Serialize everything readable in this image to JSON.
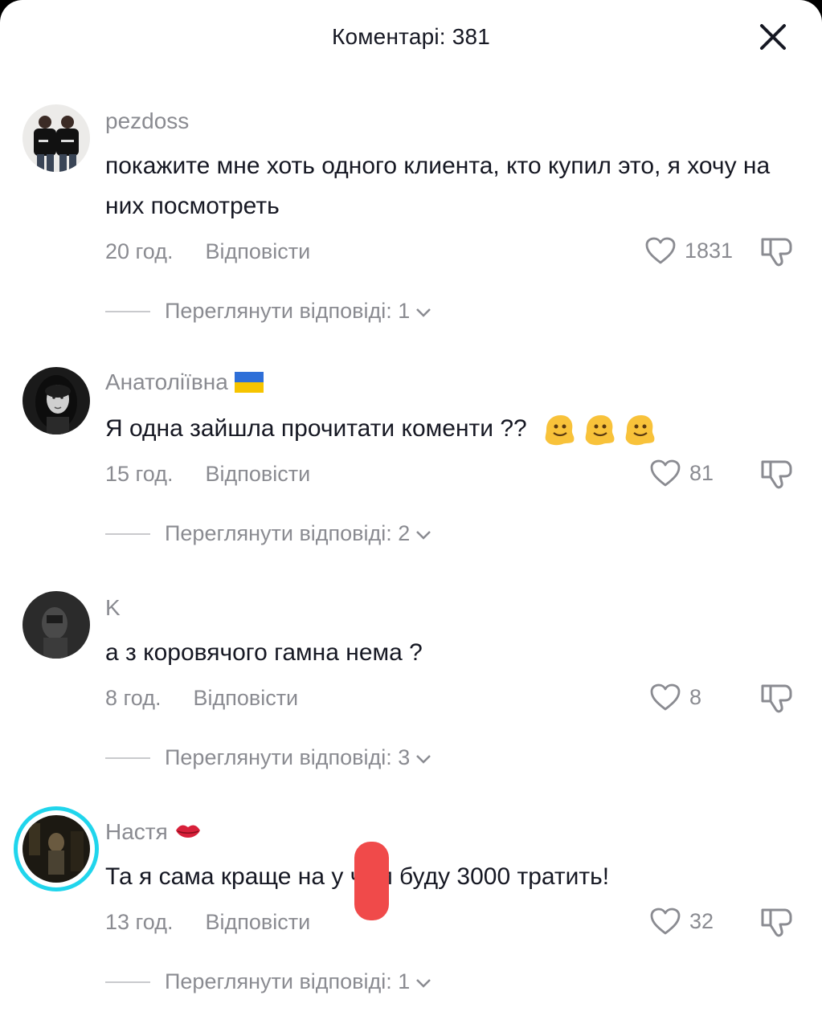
{
  "header": {
    "title": "Коментарі: 381"
  },
  "comments": [
    {
      "username": "pezdoss",
      "badge": "",
      "text": "покажите мне хоть одного клиента, кто купил это, я хочу на них посмотреть",
      "time": "20 год.",
      "reply_label": "Відповісти",
      "likes": "1831",
      "view_replies": "Переглянути відповіді: 1",
      "avatar": "couple-tshirts-photo"
    },
    {
      "username": "Анатоліївна",
      "badge": "ukraine-flag-icon",
      "text": "Я одна зайшла прочитати коменти ??",
      "text_emoji": "melting-face-icon x3",
      "time": "15 год.",
      "reply_label": "Відповісти",
      "likes": "81",
      "view_replies": "Переглянути відповіді: 2",
      "avatar": "woman-portrait-bw"
    },
    {
      "username": "K",
      "badge": "",
      "text": "а з коровячого гамна нема ?",
      "time": "8 год.",
      "reply_label": "Відповісти",
      "likes": "8",
      "view_replies": "Переглянути відповіді: 3",
      "avatar": "dark-figure-photo"
    },
    {
      "username": "Настя",
      "badge": "kiss-lips-icon",
      "text": "Та я сама краще на   у чим буду 3000 тратить!",
      "time": "13 год.",
      "reply_label": "Відповісти",
      "likes": "32",
      "view_replies": "Переглянути відповіді: 1",
      "avatar": "dark-room-photo-story-ring"
    }
  ],
  "colors": {
    "text": "#161823",
    "muted": "#8a8b91",
    "story_ring": "#20d5ec",
    "redaction": "#f04a4a"
  }
}
